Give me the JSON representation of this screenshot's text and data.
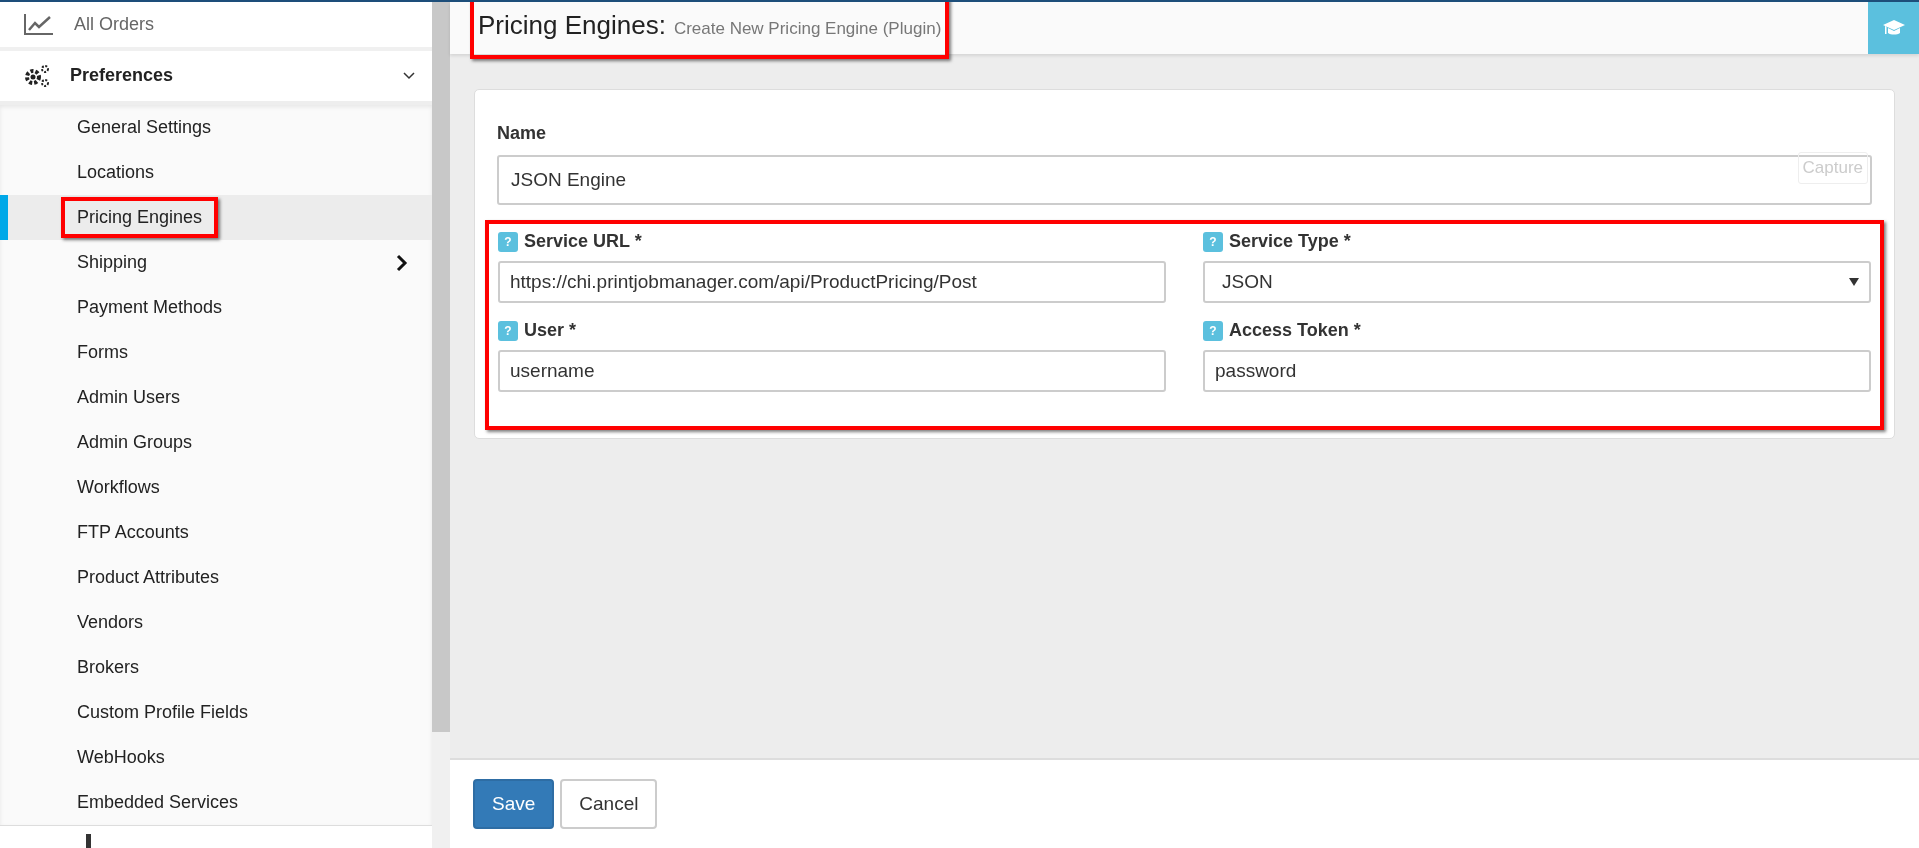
{
  "sidebar": {
    "top_item": {
      "label": "All Orders"
    },
    "section": {
      "label": "Preferences",
      "expanded": true
    },
    "items": [
      {
        "label": "General Settings",
        "selected": false,
        "highlighted": false,
        "has_submenu": false
      },
      {
        "label": "Locations",
        "selected": false,
        "highlighted": false,
        "has_submenu": false
      },
      {
        "label": "Pricing Engines",
        "selected": true,
        "highlighted": true,
        "has_submenu": false
      },
      {
        "label": "Shipping",
        "selected": false,
        "highlighted": false,
        "has_submenu": true
      },
      {
        "label": "Payment Methods",
        "selected": false,
        "highlighted": false,
        "has_submenu": false
      },
      {
        "label": "Forms",
        "selected": false,
        "highlighted": false,
        "has_submenu": false
      },
      {
        "label": "Admin Users",
        "selected": false,
        "highlighted": false,
        "has_submenu": false
      },
      {
        "label": "Admin Groups",
        "selected": false,
        "highlighted": false,
        "has_submenu": false
      },
      {
        "label": "Workflows",
        "selected": false,
        "highlighted": false,
        "has_submenu": false
      },
      {
        "label": "FTP Accounts",
        "selected": false,
        "highlighted": false,
        "has_submenu": false
      },
      {
        "label": "Product Attributes",
        "selected": false,
        "highlighted": false,
        "has_submenu": false
      },
      {
        "label": "Vendors",
        "selected": false,
        "highlighted": false,
        "has_submenu": false
      },
      {
        "label": "Brokers",
        "selected": false,
        "highlighted": false,
        "has_submenu": false
      },
      {
        "label": "Custom Profile Fields",
        "selected": false,
        "highlighted": false,
        "has_submenu": false
      },
      {
        "label": "WebHooks",
        "selected": false,
        "highlighted": false,
        "has_submenu": false
      },
      {
        "label": "Embedded Services",
        "selected": false,
        "highlighted": false,
        "has_submenu": false
      }
    ]
  },
  "header": {
    "title": "Pricing Engines:",
    "subtitle": "Create New Pricing Engine (Plugin)",
    "highlighted": true
  },
  "form": {
    "name_field": {
      "label": "Name",
      "value": "JSON Engine",
      "overlay_button": "Capture"
    },
    "credentials": {
      "highlighted": true,
      "fields": [
        {
          "kind": "text",
          "help": "?",
          "label": "Service URL *",
          "value": "https://chi.printjobmanager.com/api/ProductPricing/Post"
        },
        {
          "kind": "select",
          "help": "?",
          "label": "Service Type *",
          "value": "JSON"
        },
        {
          "kind": "text",
          "help": "?",
          "label": "User *",
          "value": "username"
        },
        {
          "kind": "text",
          "help": "?",
          "label": "Access Token *",
          "value": "password"
        }
      ]
    }
  },
  "buttons": [
    {
      "label": "Save",
      "primary": true
    },
    {
      "label": "Cancel",
      "primary": false
    }
  ]
}
